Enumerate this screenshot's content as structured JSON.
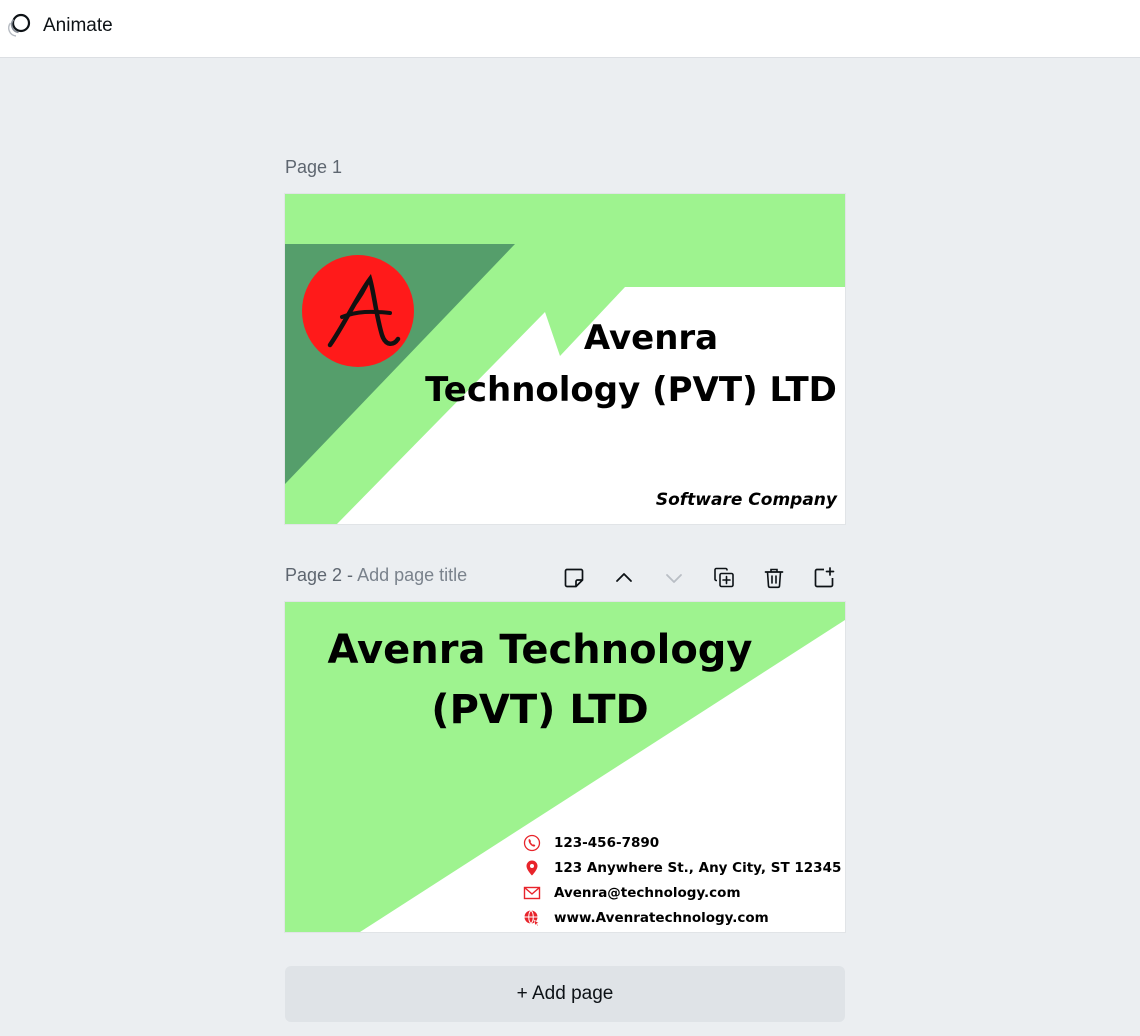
{
  "toolbar": {
    "animate_label": "Animate",
    "animate_icon": "animate-icon"
  },
  "pages": [
    {
      "label": "Page 1",
      "design": {
        "title_line1": "Avenra",
        "title_line2": "Technology (PVT) LTD",
        "subtitle": "Software Company",
        "logo_letter": "A",
        "colors": {
          "light_green": "#9ef38f",
          "dark_green": "#559e6b",
          "logo_red": "#ff1a1a"
        }
      }
    },
    {
      "label": "Page 2 - ",
      "title_placeholder": "Add page title",
      "tools": [
        {
          "name": "add-note-icon"
        },
        {
          "name": "move-up-icon"
        },
        {
          "name": "move-down-icon"
        },
        {
          "name": "duplicate-page-icon"
        },
        {
          "name": "delete-page-icon"
        },
        {
          "name": "add-page-after-icon"
        }
      ],
      "design": {
        "title_line1": "Avenra Technology",
        "title_line2": "(PVT) LTD",
        "contacts": [
          {
            "icon": "phone-icon",
            "text": "123-456-7890"
          },
          {
            "icon": "location-pin-icon",
            "text": "123 Anywhere St., Any City, ST 12345"
          },
          {
            "icon": "email-icon",
            "text": "Avenra@technology.com"
          },
          {
            "icon": "globe-icon",
            "text": "www.Avenratechnology.com"
          }
        ],
        "colors": {
          "light_green": "#9ef38f",
          "icon_red": "#e8242b"
        }
      }
    }
  ],
  "add_page_label": "+ Add page"
}
